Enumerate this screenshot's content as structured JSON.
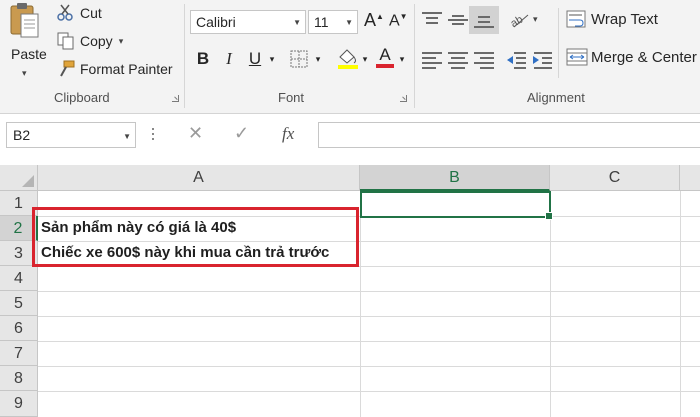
{
  "ribbon": {
    "clipboard": {
      "paste_label": "Paste",
      "cut_label": "Cut",
      "copy_label": "Copy",
      "format_painter_label": "Format Painter",
      "group_label": "Clipboard"
    },
    "font": {
      "font_name": "Calibri",
      "font_size": "11",
      "bold_label": "B",
      "italic_label": "I",
      "underline_label": "U",
      "group_label": "Font",
      "fill_color": "#ffff00",
      "font_color": "#d9242e"
    },
    "alignment": {
      "wrap_text_label": "Wrap Text",
      "merge_center_label": "Merge & Center",
      "group_label": "Alignment"
    }
  },
  "formula_bar": {
    "name_box": "B2",
    "fx_label": "fx",
    "formula_value": ""
  },
  "sheet": {
    "columns": [
      "A",
      "B",
      "C"
    ],
    "selected_column": "B",
    "rows": [
      "1",
      "2",
      "3",
      "4",
      "5",
      "6",
      "7",
      "8",
      "9"
    ],
    "cells": {
      "A2": "Sản phẩm này có giá là 40$",
      "A3": "Chiếc xe 600$ này khi mua cần trả trước"
    },
    "selected_cell": "B2",
    "accent_color": "#217346",
    "annotation_color": "#d9242e"
  }
}
